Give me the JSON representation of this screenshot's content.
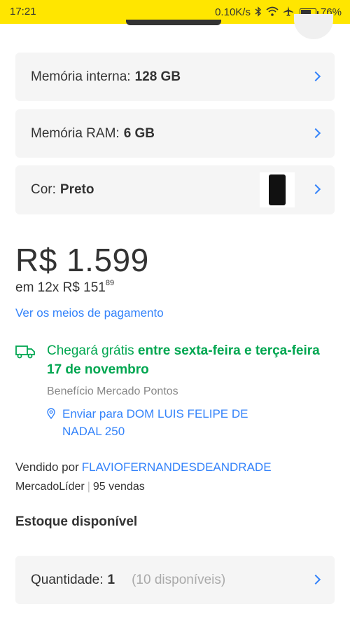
{
  "status_bar": {
    "time": "17:21",
    "network_speed": "0.10K/s",
    "battery_percent": "76%",
    "battery_level": 0.76,
    "icons": [
      "bluetooth-icon",
      "wifi-icon",
      "airplane-icon",
      "battery-icon"
    ]
  },
  "variants": {
    "internal_memory": {
      "label": "Memória interna:",
      "value": "128 GB"
    },
    "ram": {
      "label": "Memória RAM:",
      "value": "6 GB"
    },
    "color": {
      "label": "Cor:",
      "value": "Preto"
    }
  },
  "price": {
    "main": "R$ 1.599",
    "installments_prefix": "em 12x R$ 151",
    "installments_cents": "89",
    "payment_link": "Ver os meios de pagamento"
  },
  "shipping": {
    "prefix": "Chegará grátis ",
    "dates": "entre sexta-feira e terça-feira 17 de novembro",
    "benefit": "Benefício Mercado Pontos",
    "address": "Enviar para DOM LUIS FELIPE DE NADAL 250"
  },
  "seller": {
    "label": "Vendido por",
    "name": "FLAVIOFERNANDESDEANDRADE",
    "badge": "MercadoLíder",
    "separator": "|",
    "sales": "95 vendas"
  },
  "stock": {
    "title": "Estoque disponível",
    "quantity_label": "Quantidade:",
    "quantity_value": "1",
    "available": "(10 disponíveis)"
  },
  "colors": {
    "brand_yellow": "#ffe600",
    "link_blue": "#3483fa",
    "success_green": "#00a650"
  }
}
